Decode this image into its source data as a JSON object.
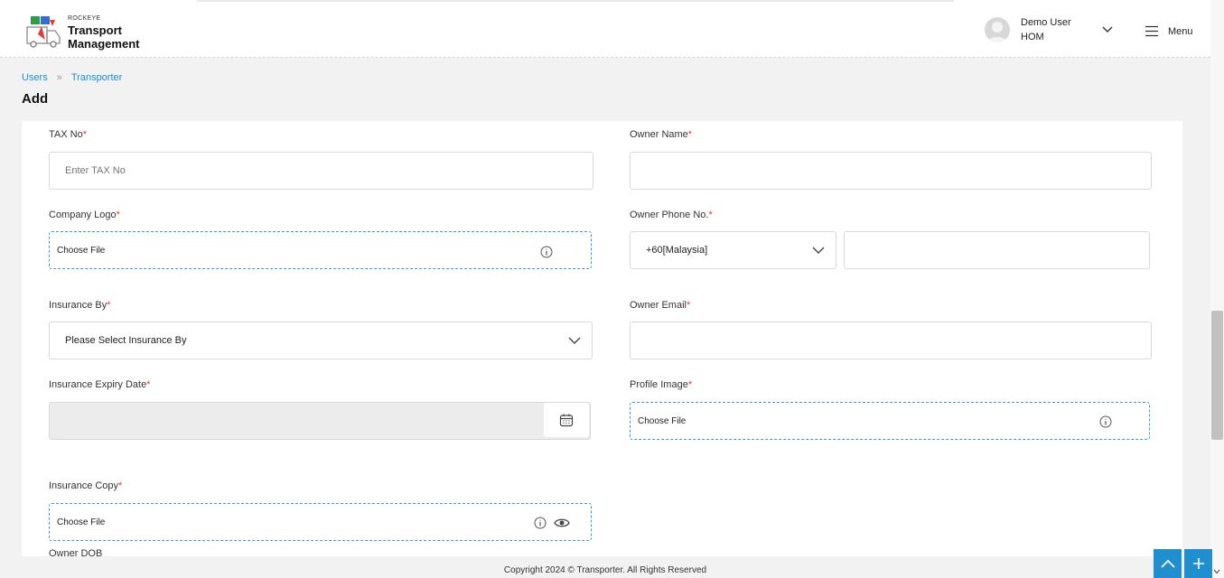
{
  "brand": {
    "company": "ROCKEYE",
    "line1": "Transport",
    "line2": "Management"
  },
  "user": {
    "name": "Demo User",
    "role": "HOM"
  },
  "menu": {
    "label": "Menu"
  },
  "breadcrumb": {
    "items": [
      "Users",
      "Transporter"
    ],
    "separator": "»"
  },
  "page": {
    "title": "Add"
  },
  "form": {
    "tax_no": {
      "label": "TAX No",
      "placeholder": "Enter TAX No",
      "value": ""
    },
    "owner_name": {
      "label": "Owner Name",
      "value": ""
    },
    "company_logo": {
      "label": "Company Logo",
      "button": "Choose File"
    },
    "owner_phone": {
      "label": "Owner Phone No.",
      "country_code": "+60[Malaysia]",
      "value": ""
    },
    "insurance_by": {
      "label": "Insurance By",
      "selected": "Please Select Insurance By"
    },
    "owner_email": {
      "label": "Owner Email",
      "value": ""
    },
    "insurance_expiry": {
      "label": "Insurance Expiry Date",
      "value": ""
    },
    "profile_image": {
      "label": "Profile Image",
      "button": "Choose File"
    },
    "insurance_copy": {
      "label": "Insurance Copy",
      "button": "Choose File"
    },
    "owner_dob": {
      "label": "Owner DOB"
    },
    "required_mark": "*"
  },
  "footer": {
    "text": "Copyright 2024 © Transporter. All Rights Reserved"
  },
  "colors": {
    "accent": "#1f8fd0",
    "link": "#1a8fd1",
    "required": "#e53935",
    "file_border": "#3b9ad6"
  },
  "icons": [
    "truck-logo-icon",
    "user-avatar-icon",
    "chevron-down-icon",
    "hamburger-menu-icon",
    "info-icon",
    "eye-icon",
    "calendar-icon",
    "chevron-up-icon",
    "plus-icon"
  ]
}
